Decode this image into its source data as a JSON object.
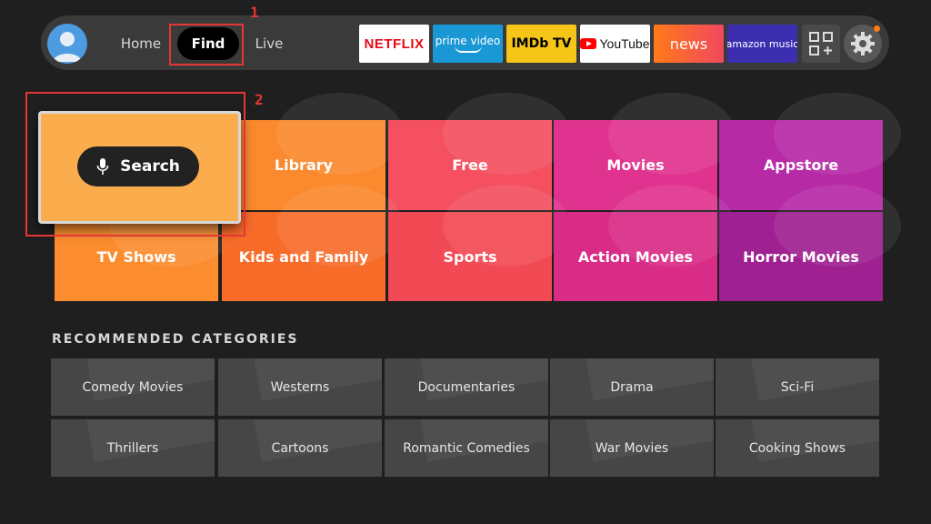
{
  "nav": {
    "home": "Home",
    "find": "Find",
    "live": "Live"
  },
  "apps": {
    "netflix": "NETFLIX",
    "prime_video": "prime video",
    "imdb_tv": "IMDb TV",
    "youtube": "YouTube",
    "news": "news",
    "amazon_music": "amazon music"
  },
  "annotations": [
    "1",
    "2"
  ],
  "find_tiles": [
    {
      "label": "Search",
      "color": "#fbad4d"
    },
    {
      "label": "Library",
      "color": "#fb8a2e"
    },
    {
      "label": "Free",
      "color": "#f4505f"
    },
    {
      "label": "Movies",
      "color": "#e0338f"
    },
    {
      "label": "Appstore",
      "color": "#b72aa6"
    },
    {
      "label": "TV Shows",
      "color": "#fb8d2f"
    },
    {
      "label": "Kids and Family",
      "color": "#f86c2a"
    },
    {
      "label": "Sports",
      "color": "#f24a54"
    },
    {
      "label": "Action Movies",
      "color": "#d92c86"
    },
    {
      "label": "Horror Movies",
      "color": "#9e2091"
    }
  ],
  "recommended": {
    "title": "RECOMMENDED CATEGORIES",
    "items": [
      "Comedy Movies",
      "Westerns",
      "Documentaries",
      "Drama",
      "Sci-Fi",
      "Thrillers",
      "Cartoons",
      "Romantic Comedies",
      "War Movies",
      "Cooking Shows"
    ]
  },
  "icons": {
    "avatar": "user-avatar-icon",
    "mic": "microphone-icon",
    "apps": "app-grid-icon",
    "settings": "gear-icon"
  }
}
